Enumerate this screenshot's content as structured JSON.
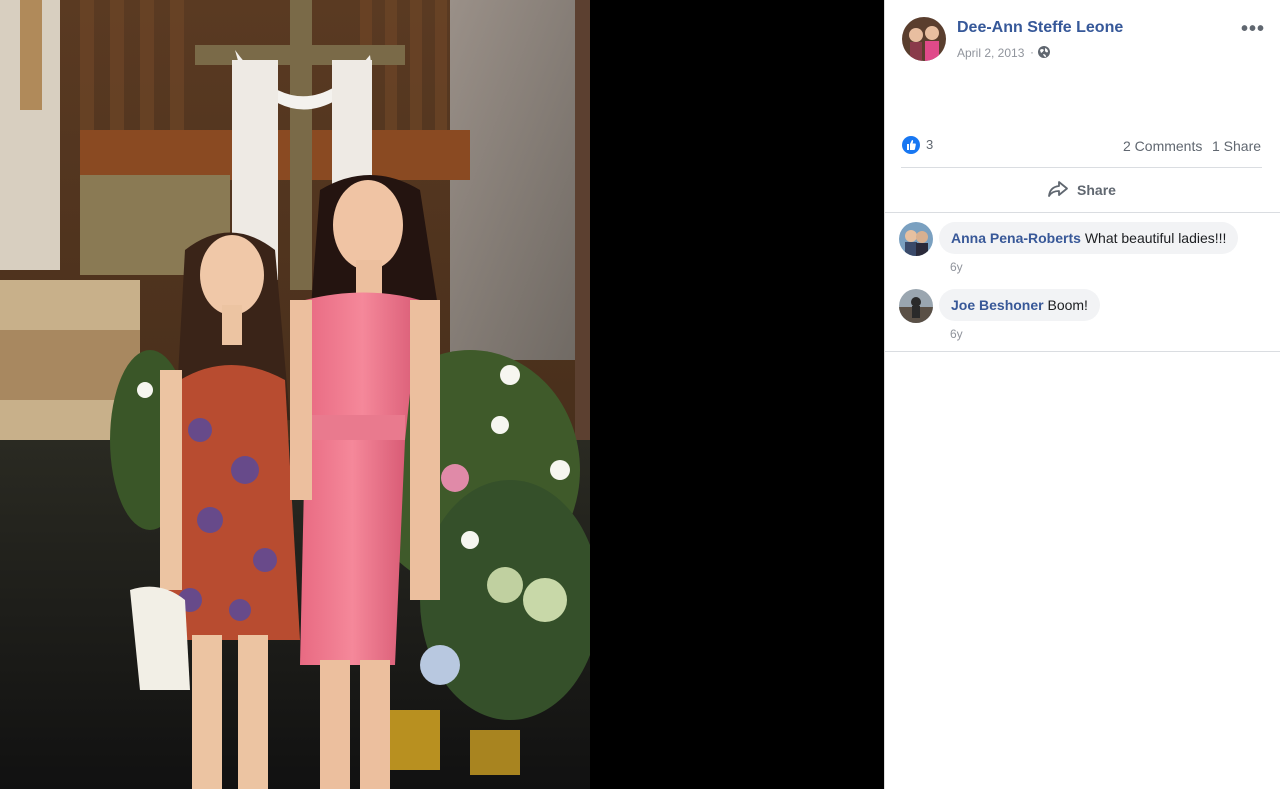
{
  "post": {
    "author": "Dee-Ann Steffe Leone",
    "date": "April 2, 2013",
    "separator": "·",
    "privacy_icon": "globe-icon",
    "more_label": "•••"
  },
  "stats": {
    "likes": "3",
    "comments": "2 Comments",
    "shares": "1 Share"
  },
  "actions": {
    "share_label": "Share"
  },
  "comments": [
    {
      "author": "Anna Pena-Roberts",
      "text": "What beautiful ladies!!!",
      "time": "6y"
    },
    {
      "author": "Joe Beshoner",
      "text": "Boom!",
      "time": "6y"
    }
  ],
  "colors": {
    "link": "#365899",
    "like_blue": "#1877f2",
    "muted": "#90949c"
  }
}
